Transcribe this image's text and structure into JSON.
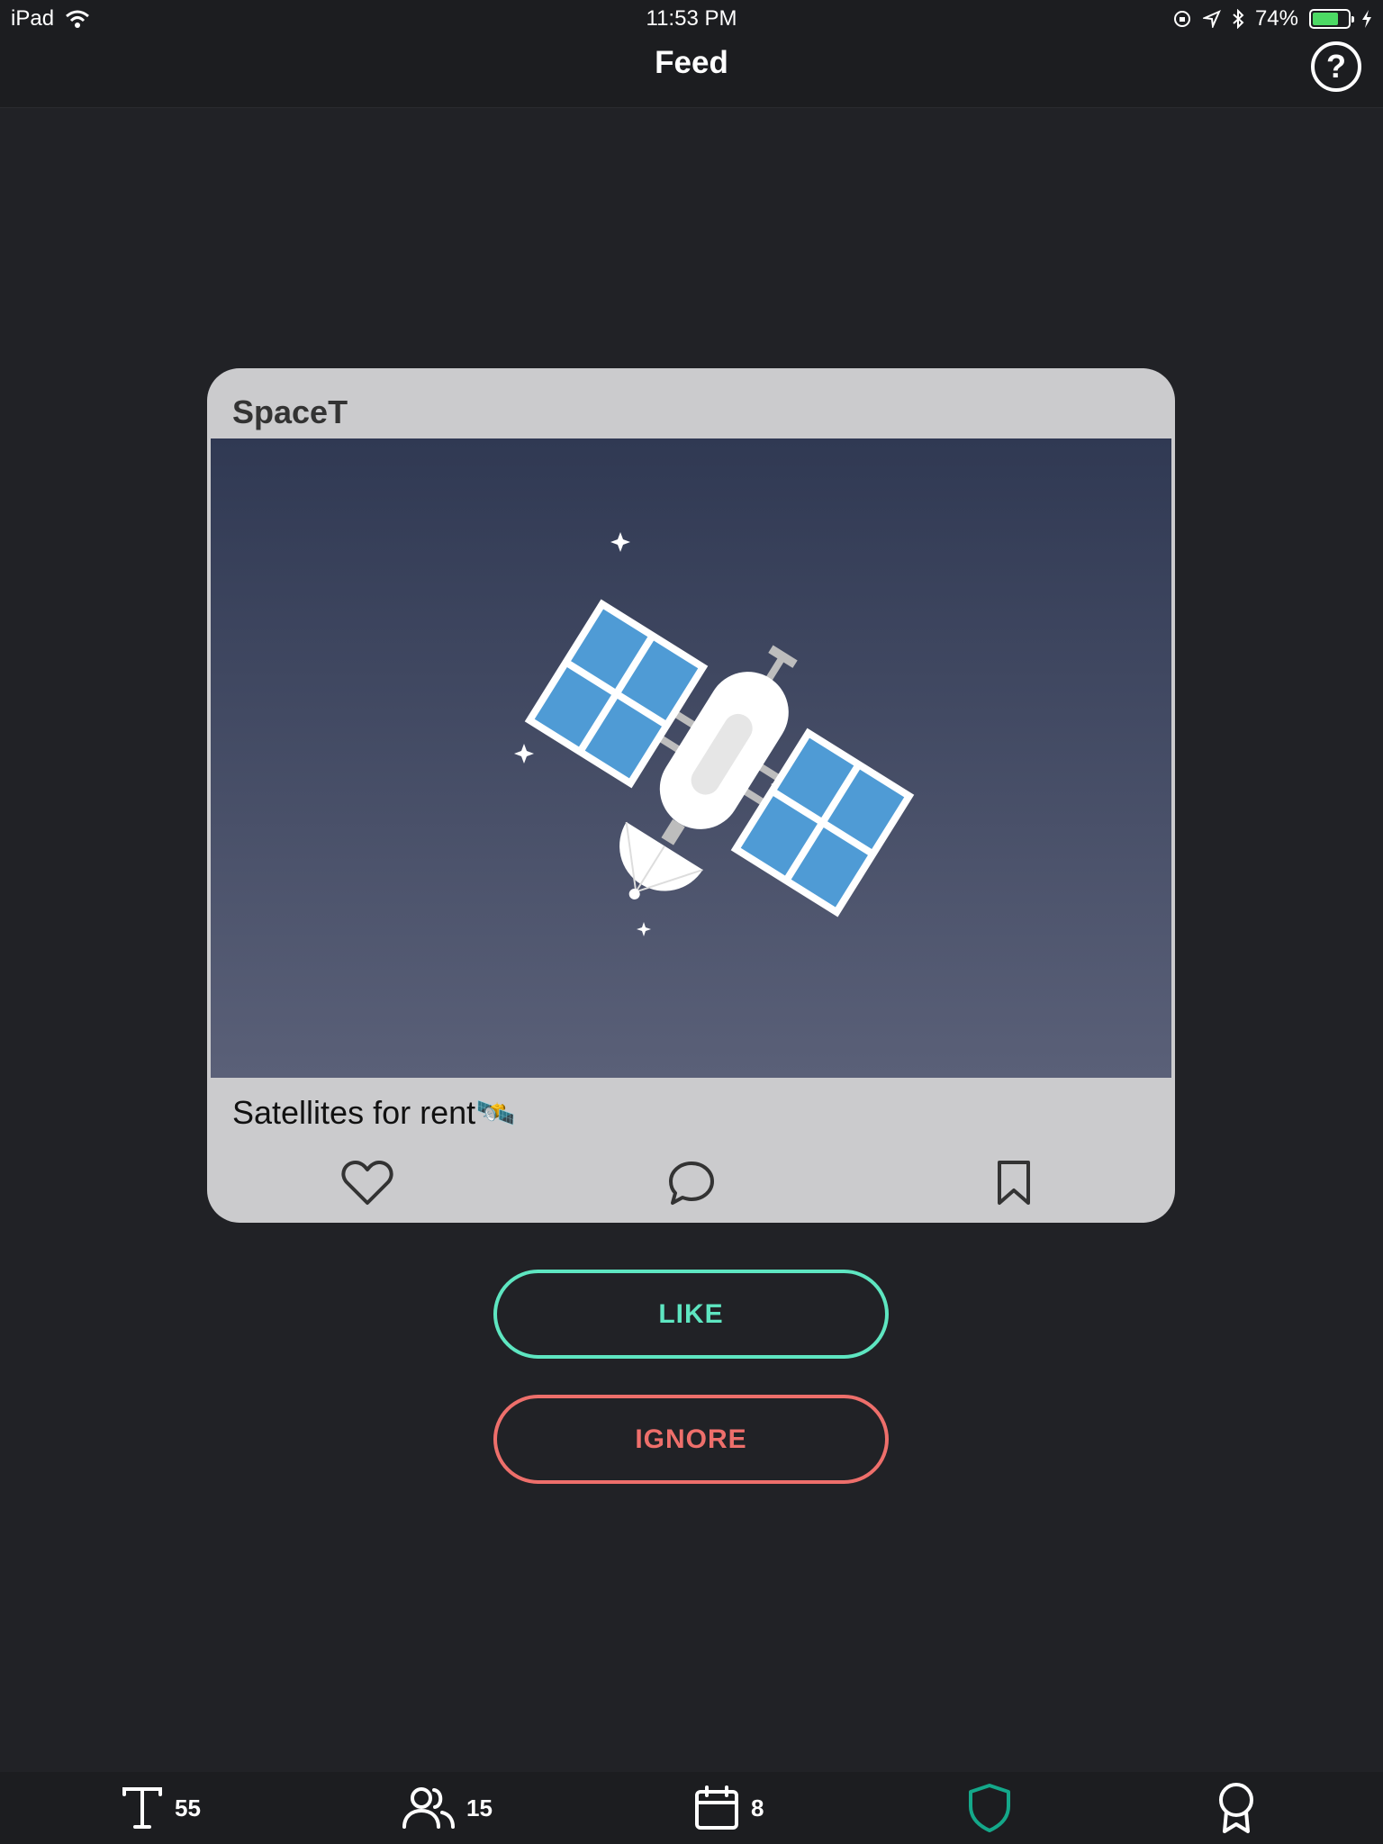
{
  "status_bar": {
    "device": "iPad",
    "time": "11:53 PM",
    "battery_percent": "74%",
    "battery_level": 0.74,
    "battery_color": "#4cd964"
  },
  "nav": {
    "title": "Feed",
    "help_icon": "question-circle-icon",
    "help_glyph": "?"
  },
  "post": {
    "author": "SpaceT",
    "image_icon": "satellite-illustration",
    "caption": "Satellites for rent🛰️",
    "actions": [
      "heart-icon",
      "comment-icon",
      "bookmark-icon"
    ]
  },
  "buttons": {
    "like_label": "LIKE",
    "ignore_label": "IGNORE",
    "like_color": "#5ee6c1",
    "ignore_color": "#ee6f6b"
  },
  "tabs": [
    {
      "icon": "text-icon",
      "count": "55"
    },
    {
      "icon": "users-icon",
      "count": "15"
    },
    {
      "icon": "calendar-icon",
      "count": "8"
    },
    {
      "icon": "shield-icon",
      "count": "",
      "active": true,
      "color": "#14a88a"
    },
    {
      "icon": "award-icon",
      "count": ""
    }
  ]
}
